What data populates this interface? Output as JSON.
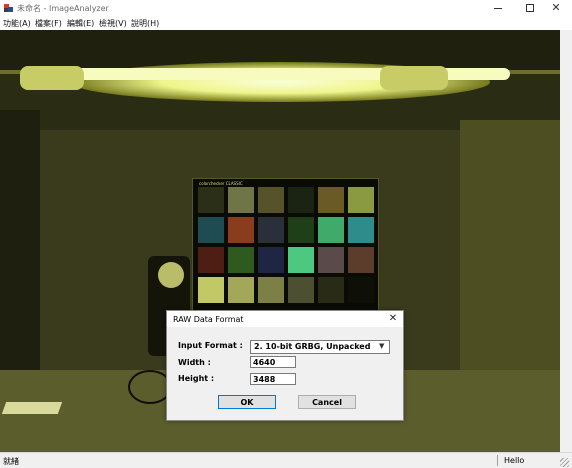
{
  "window": {
    "title": "未命名 - ImageAnalyzer",
    "close_glyph": "✕"
  },
  "menu": [
    {
      "label": "功能(A)"
    },
    {
      "label": "檔案(F)"
    },
    {
      "label": "編輯(E)"
    },
    {
      "label": "檢視(V)"
    },
    {
      "label": "說明(H)"
    }
  ],
  "scene": {
    "chart_brand": "colorchecker CLASSIC",
    "patches": [
      "#2b2f17",
      "#6f7547",
      "#56532a",
      "#1b2413",
      "#6a5a26",
      "#8a9a40",
      "#1f4b52",
      "#8a3d1c",
      "#2a2f3a",
      "#1f3f19",
      "#3faa6a",
      "#2e8d8a",
      "#4e1d14",
      "#2f5a1f",
      "#1f2644",
      "#4dc880",
      "#5a4a4a",
      "#5c3d2b",
      "#c2c865",
      "#a2a75a",
      "#7d8046",
      "#4d5030",
      "#2a2b16",
      "#0e0f07"
    ]
  },
  "dialog": {
    "title": "RAW Data Format",
    "close_glyph": "✕",
    "input_format_label": "Input Format :",
    "input_format_value": "2. 10-bit GRBG, Unpacked",
    "width_label": "Width :",
    "width_value": "4640",
    "height_label": "Height :",
    "height_value": "3488",
    "ok_label": "OK",
    "cancel_label": "Cancel"
  },
  "status": {
    "ready": "就緒",
    "message": "Hello"
  }
}
